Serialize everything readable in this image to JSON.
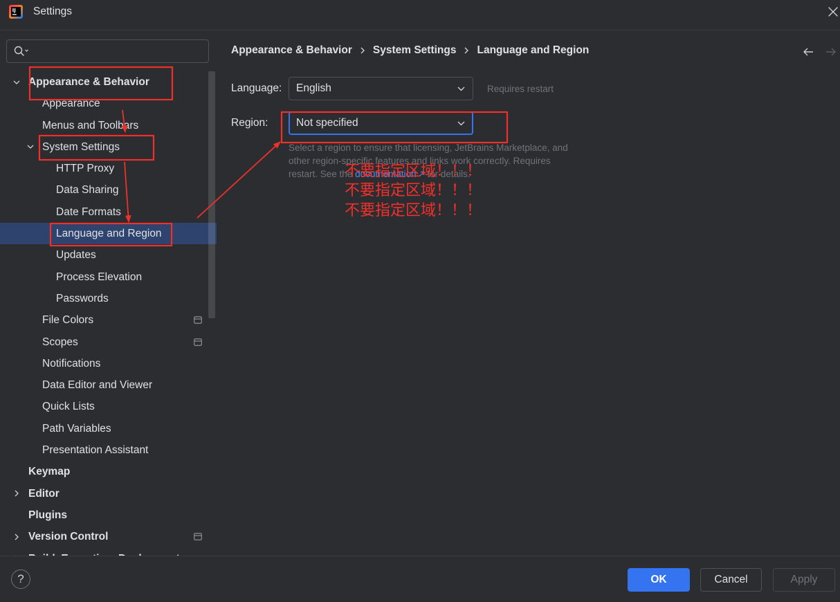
{
  "window": {
    "title": "Settings",
    "logo_text": "IJ"
  },
  "icons": {
    "app_logo": "intellij-idea-logo-icon",
    "close": "close-icon",
    "search": "search-icon",
    "expanded": "chevron-down-icon",
    "collapsed": "chevron-right-icon",
    "project_level": "project-settings-icon",
    "breadcrumb_separator": "chevron-right-icon",
    "back": "arrow-left-icon",
    "forward": "arrow-right-icon",
    "dropdown": "chevron-down-icon",
    "external_link": "external-link-icon",
    "help": "help-icon"
  },
  "colors": {
    "background": "#2b2d30",
    "text": "#dfe1e5",
    "secondary_text": "#6f737a",
    "accent": "#3574f0",
    "selection": "#2e436e",
    "link": "#548af7",
    "annotation": "#f0302b"
  },
  "search": {
    "value": "",
    "placeholder": ""
  },
  "tree": [
    {
      "label": "Appearance & Behavior",
      "expanded": true,
      "children": [
        {
          "label": "Appearance"
        },
        {
          "label": "Menus and Toolbars"
        },
        {
          "label": "System Settings",
          "expanded": true,
          "children": [
            {
              "label": "HTTP Proxy"
            },
            {
              "label": "Data Sharing"
            },
            {
              "label": "Date Formats"
            },
            {
              "label": "Language and Region",
              "selected": true
            },
            {
              "label": "Updates"
            },
            {
              "label": "Process Elevation"
            },
            {
              "label": "Passwords"
            }
          ]
        },
        {
          "label": "File Colors",
          "project_level": true
        },
        {
          "label": "Scopes",
          "project_level": true
        },
        {
          "label": "Notifications"
        },
        {
          "label": "Data Editor and Viewer"
        },
        {
          "label": "Quick Lists"
        },
        {
          "label": "Path Variables"
        },
        {
          "label": "Presentation Assistant"
        }
      ]
    },
    {
      "label": "Keymap"
    },
    {
      "label": "Editor",
      "expanded": false
    },
    {
      "label": "Plugins"
    },
    {
      "label": "Version Control",
      "expanded": false,
      "project_level": true
    },
    {
      "label": "Build, Execution, Deployment",
      "expanded": false
    }
  ],
  "breadcrumb": [
    "Appearance & Behavior",
    "System Settings",
    "Language and Region"
  ],
  "navigation": {
    "back_enabled": true,
    "forward_enabled": false
  },
  "form": {
    "language": {
      "label": "Language:",
      "value": "English",
      "hint": "Requires restart"
    },
    "region": {
      "label": "Region:",
      "value": "Not specified",
      "focused": true,
      "help": {
        "before": "Select a region to ensure that licensing, JetBrains Marketplace, and other region-specific features and links work correctly. Requires restart. See the",
        "link": "documentation",
        "after": "for details."
      }
    }
  },
  "annotation": {
    "lines": [
      "不要指定区域！！！",
      "不要指定区域！！！",
      "不要指定区域！！！"
    ]
  },
  "footer": {
    "help": "?",
    "ok": "OK",
    "cancel": "Cancel",
    "apply": "Apply",
    "apply_enabled": false
  }
}
